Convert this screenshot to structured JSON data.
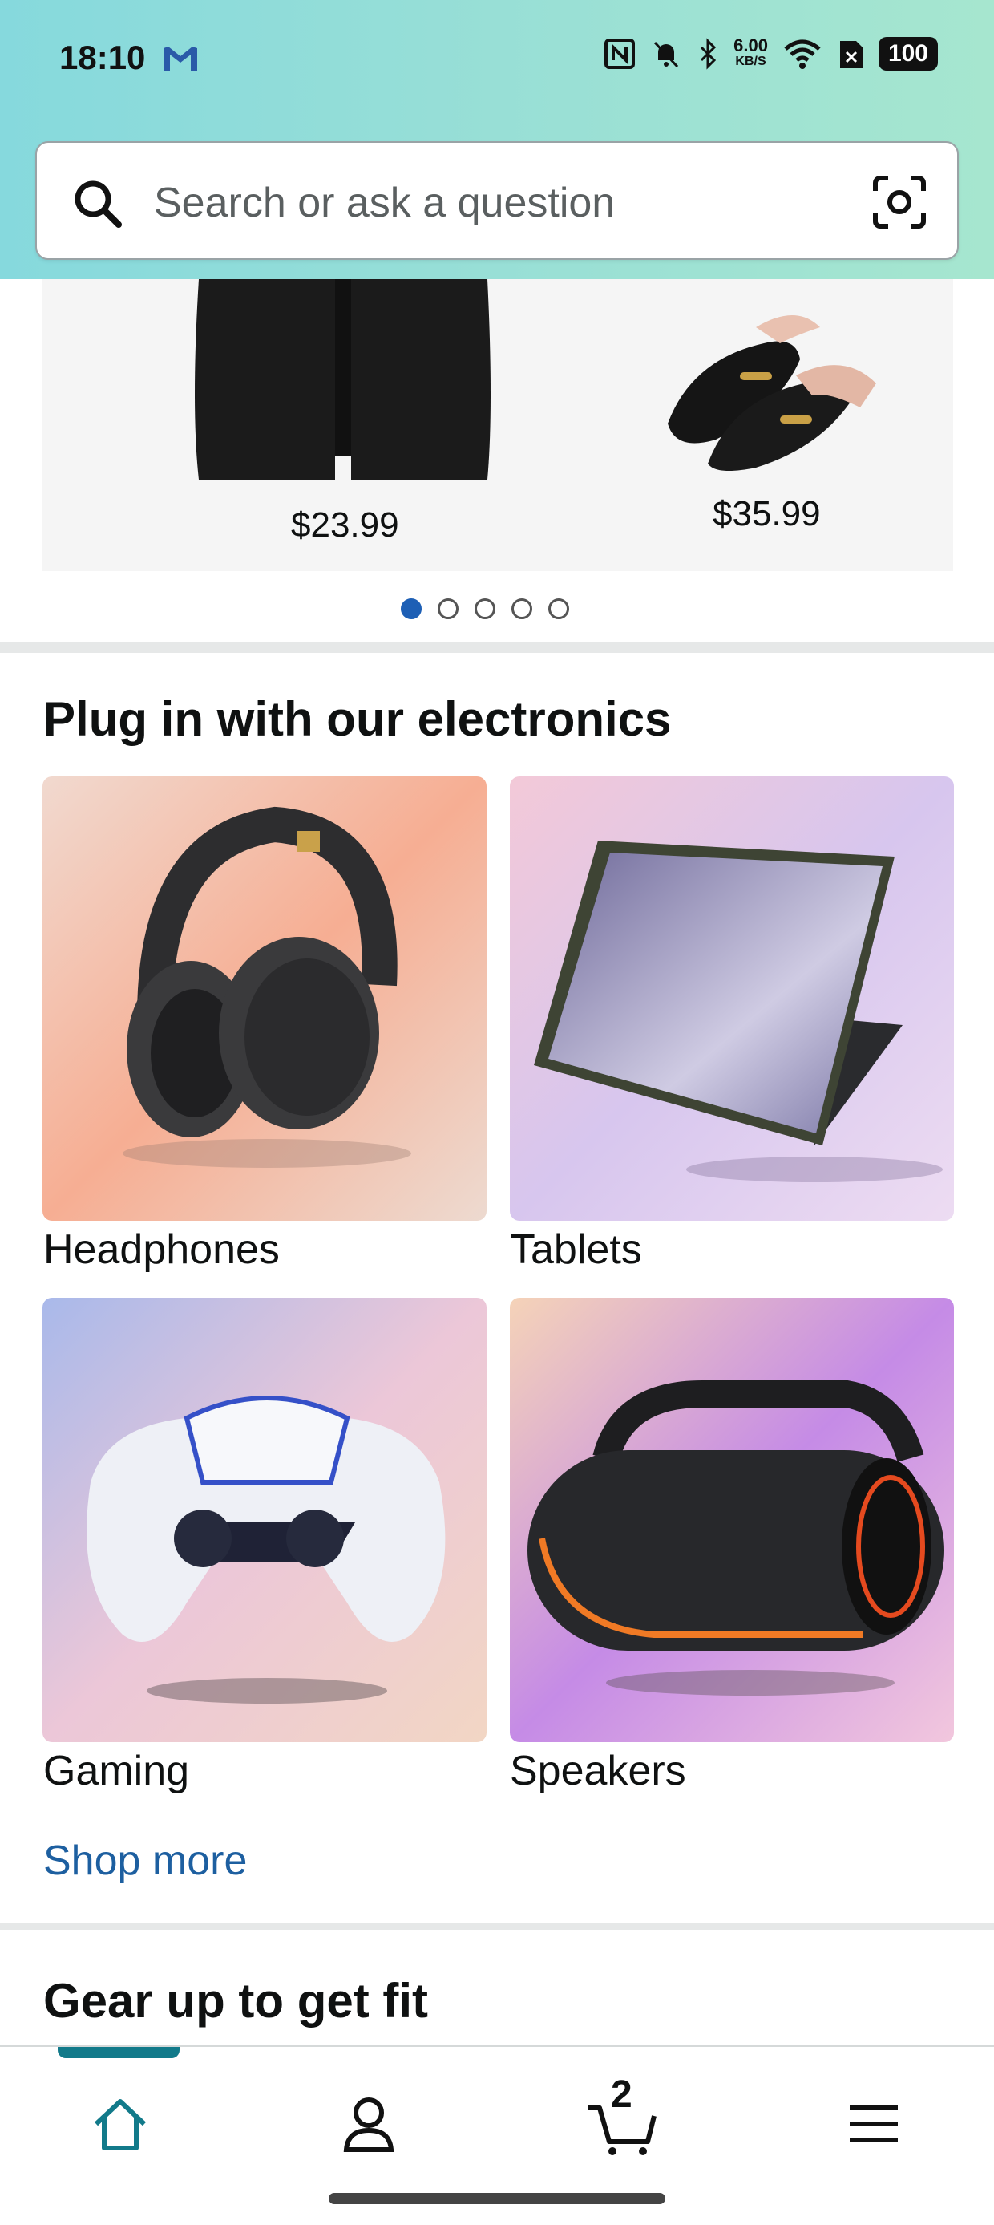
{
  "status_bar": {
    "time": "18:10",
    "network_speed": "6.00",
    "network_speed_unit": "KB/S",
    "battery": "100",
    "icons": [
      "gmail-icon",
      "nfc-icon",
      "bell-off-icon",
      "bluetooth-icon",
      "wifi-icon",
      "sim-off-icon",
      "battery-icon"
    ]
  },
  "search": {
    "placeholder": "Search or ask a question",
    "icon": "search-icon",
    "lens_icon": "camera-lens-icon"
  },
  "carousel": {
    "items": [
      {
        "name": "black shorts",
        "price": "$23.99"
      },
      {
        "name": "black loafer mules",
        "price": "$35.99"
      }
    ],
    "page_count": 5,
    "active_page": 1
  },
  "electronics": {
    "title": "Plug in with our electronics",
    "tiles": [
      {
        "label": "Headphones"
      },
      {
        "label": "Tablets"
      },
      {
        "label": "Gaming"
      },
      {
        "label": "Speakers"
      }
    ],
    "shop_more": "Shop more"
  },
  "fitness": {
    "title": "Gear up to get fit"
  },
  "bottom_nav": {
    "items": [
      {
        "icon": "home-icon",
        "active": true
      },
      {
        "icon": "account-icon",
        "active": false
      },
      {
        "icon": "cart-icon",
        "active": false
      },
      {
        "icon": "menu-icon",
        "active": false
      }
    ],
    "cart_count": "2",
    "accent": "#127a8a"
  },
  "colors": {
    "header_gradient_start": "#86d9dd",
    "header_gradient_end": "#a6e6cf",
    "link": "#1d5fa0",
    "dot_active": "#1d5fb5"
  }
}
